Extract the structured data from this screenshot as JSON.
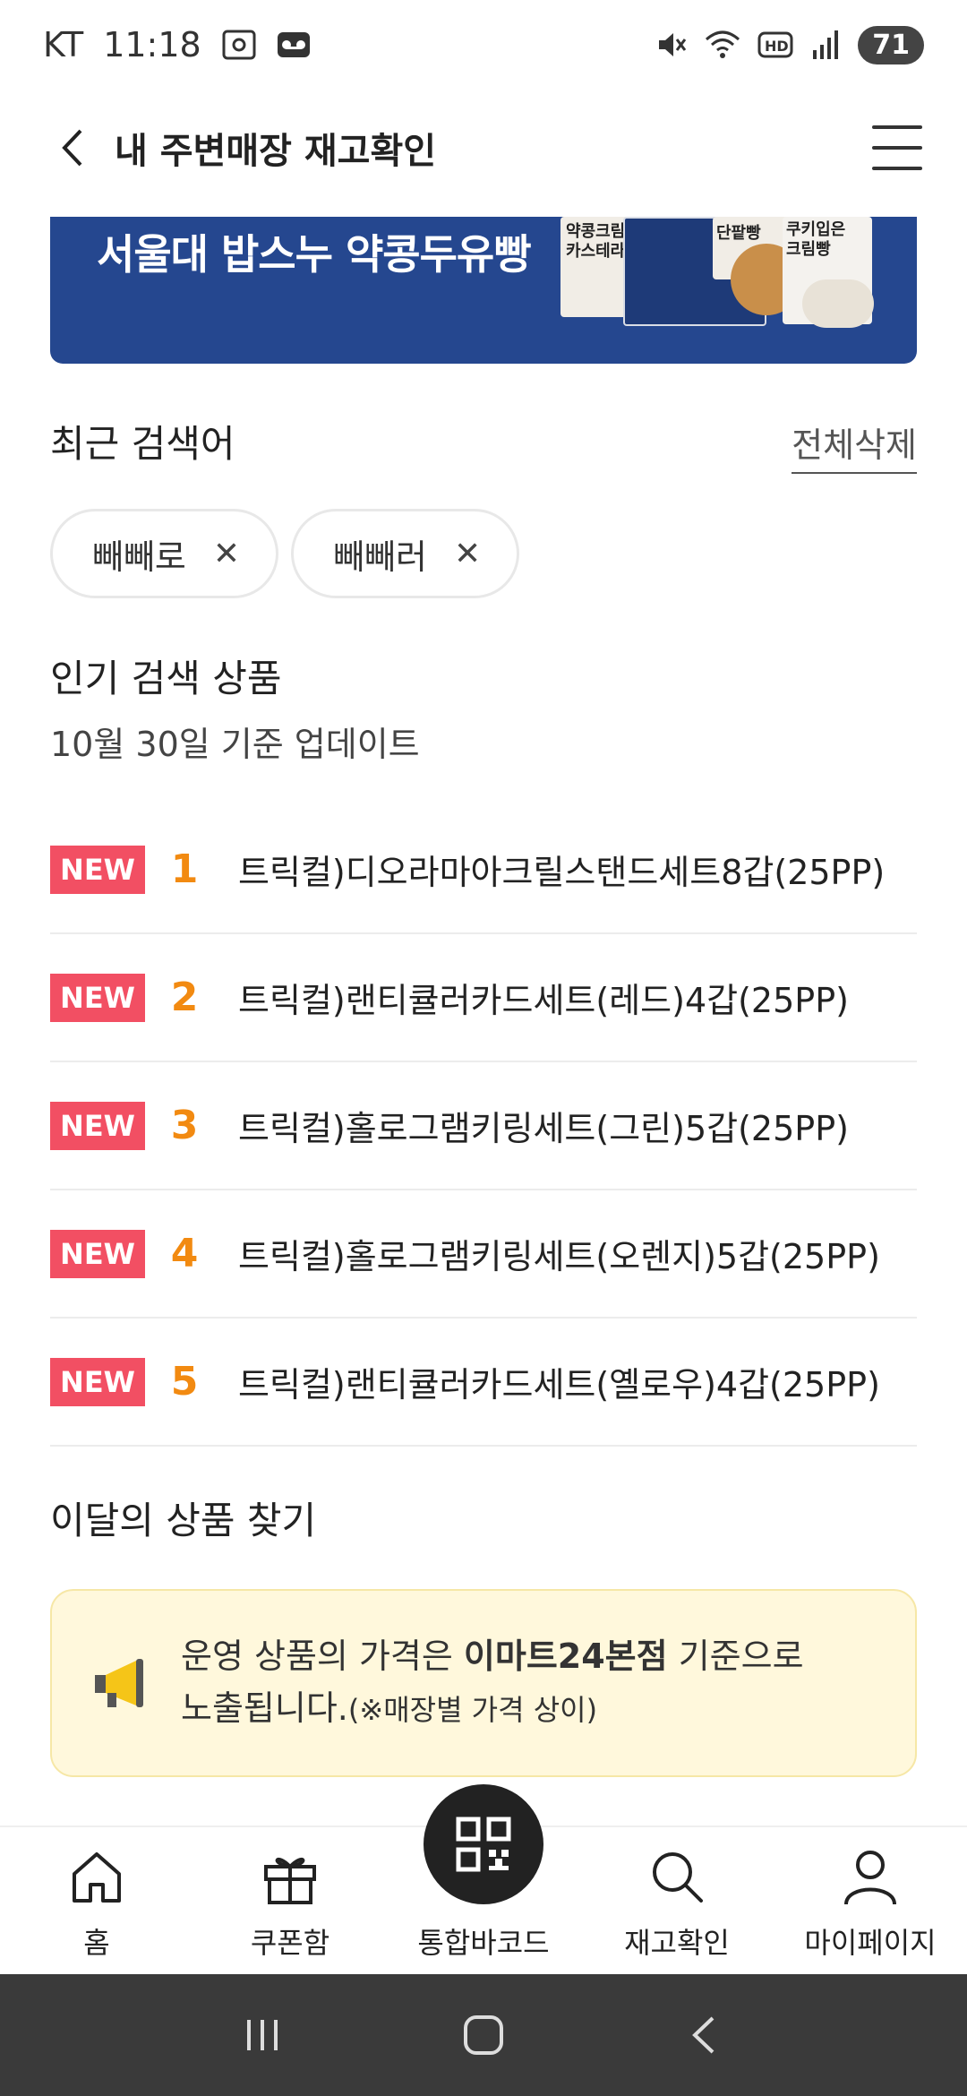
{
  "status_bar": {
    "carrier": "KT",
    "time": "11:18",
    "battery": "71"
  },
  "header": {
    "title": "내 주변매장 재고확인"
  },
  "banner": {
    "text": "서울대 밥스누 약콩두유빵",
    "product_labels": [
      "약콩크림 카스테라",
      "단팥빵",
      "쿠키입은 크림빵"
    ]
  },
  "recent": {
    "title": "최근 검색어",
    "delete_all": "전체삭제",
    "chips": [
      "빼빼로",
      "빼빼러"
    ]
  },
  "popular": {
    "title": "인기 검색 상품",
    "updated": "10월 30일 기준 업데이트",
    "badge": "NEW",
    "items": [
      {
        "rank": "1",
        "name": "트릭컬)디오라마아크릴스탠드세트8갑(25PP)"
      },
      {
        "rank": "2",
        "name": "트릭컬)랜티큘러카드세트(레드)4갑(25PP)"
      },
      {
        "rank": "3",
        "name": "트릭컬)홀로그램키링세트(그린)5갑(25PP)"
      },
      {
        "rank": "4",
        "name": "트릭컬)홀로그램키링세트(오렌지)5갑(25PP)"
      },
      {
        "rank": "5",
        "name": "트릭컬)랜티큘러카드세트(옐로우)4갑(25PP)"
      }
    ]
  },
  "monthly": {
    "title": "이달의 상품 찾기"
  },
  "notice": {
    "line1_prefix": "운영 상품의 가격은 ",
    "line1_bold": "이마트24본점",
    "line1_suffix": " 기준으로",
    "line2": "노출됩니다.",
    "line2_small": "(※매장별 가격 상이)"
  },
  "bottom_nav": {
    "home": "홈",
    "coupon": "쿠폰함",
    "barcode": "통합바코드",
    "stock": "재고확인",
    "mypage": "마이페이지"
  },
  "colors": {
    "accent_orange": "#f28a11",
    "badge_red": "#f24f63",
    "banner_blue": "#25478f",
    "notice_bg": "#fff8dc"
  }
}
